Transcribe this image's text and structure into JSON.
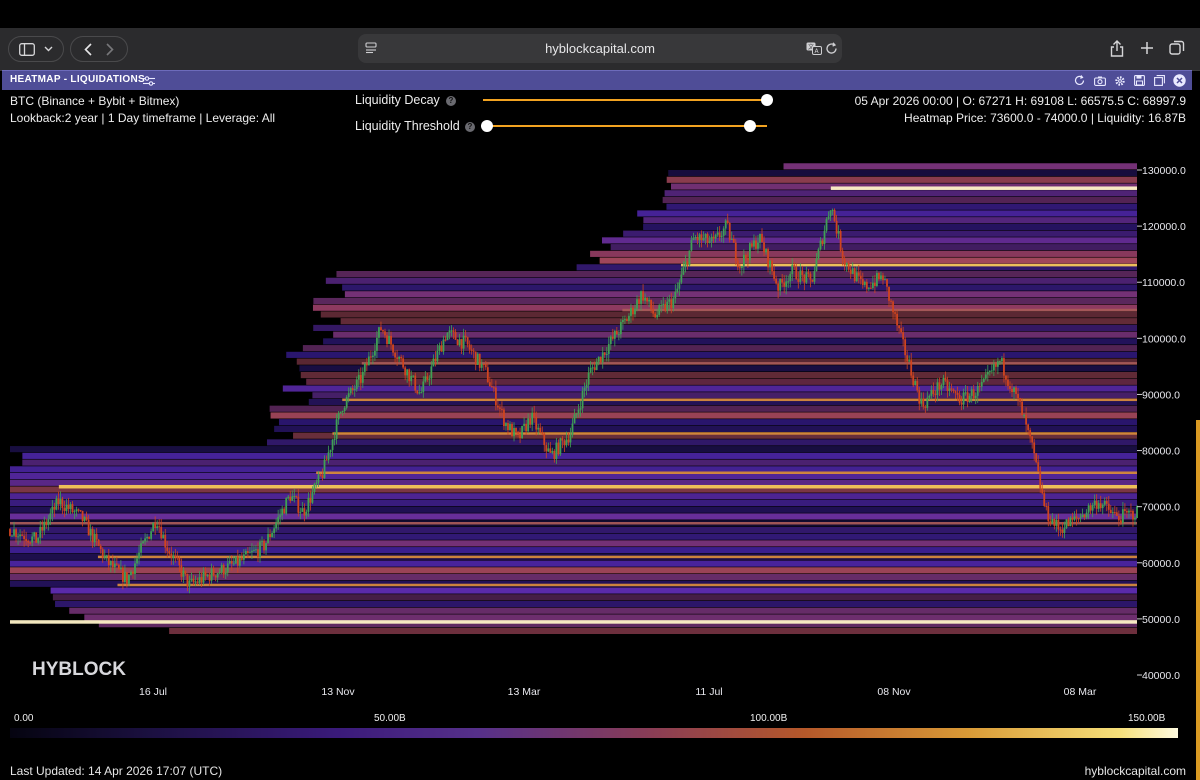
{
  "browser": {
    "url": "hyblockcapital.com"
  },
  "widget": {
    "title": "HEATMAP - LIQUIDATIONS"
  },
  "info": {
    "exchanges": "BTC (Binance + Bybit + Bitmex)",
    "settings": "Lookback:2 year | 1 Day timeframe | Leverage: All",
    "ohlc": "05 Apr 2026 00:00 | O: 67271 H: 69108 L: 66575.5 C: 68997.9",
    "heatmap_summary": "Heatmap Price: 73600.0 - 74000.0 | Liquidity: 16.87B"
  },
  "controls": {
    "decay_label": "Liquidity Decay",
    "threshold_label": "Liquidity Threshold",
    "decay_value": 1.0,
    "threshold_min": 0.0,
    "threshold_max": 0.94
  },
  "chart_data": {
    "type": "heatmap",
    "watermark": "HYBLOCK",
    "x_tick_labels": [
      "16 Jul",
      "13 Nov",
      "13 Mar",
      "11 Jul",
      "08 Nov",
      "08 Mar"
    ],
    "y_tick_labels": [
      "130000.0",
      "120000.0",
      "110000.0",
      "100000.0",
      "90000.0",
      "80000.0",
      "70000.0",
      "60000.0",
      "50000.0",
      "40000.0"
    ],
    "y_ticks": [
      130000,
      120000,
      110000,
      100000,
      90000,
      80000,
      70000,
      60000,
      50000,
      40000
    ],
    "ylim": [
      40000,
      131000
    ],
    "price_path_approx": [
      [
        0,
        66000
      ],
      [
        8,
        64000
      ],
      [
        15,
        71000
      ],
      [
        22,
        68000
      ],
      [
        30,
        60000
      ],
      [
        36,
        57000
      ],
      [
        40,
        62000
      ],
      [
        45,
        68000
      ],
      [
        48,
        63000
      ],
      [
        55,
        56000
      ],
      [
        62,
        58000
      ],
      [
        70,
        60000
      ],
      [
        78,
        63000
      ],
      [
        86,
        72000
      ],
      [
        90,
        69000
      ],
      [
        96,
        76000
      ],
      [
        102,
        88000
      ],
      [
        108,
        93000
      ],
      [
        114,
        102000
      ],
      [
        120,
        96000
      ],
      [
        126,
        90000
      ],
      [
        134,
        101000
      ],
      [
        140,
        99000
      ],
      [
        146,
        94000
      ],
      [
        152,
        85000
      ],
      [
        156,
        82000
      ],
      [
        160,
        86000
      ],
      [
        166,
        79000
      ],
      [
        172,
        83000
      ],
      [
        178,
        94000
      ],
      [
        184,
        99000
      ],
      [
        190,
        104000
      ],
      [
        194,
        108000
      ],
      [
        198,
        104000
      ],
      [
        204,
        107000
      ],
      [
        210,
        118000
      ],
      [
        216,
        117000
      ],
      [
        220,
        120000
      ],
      [
        224,
        113000
      ],
      [
        230,
        118000
      ],
      [
        236,
        109000
      ],
      [
        240,
        112000
      ],
      [
        246,
        110000
      ],
      [
        252,
        124000
      ],
      [
        256,
        114000
      ],
      [
        262,
        109000
      ],
      [
        268,
        111000
      ],
      [
        274,
        99000
      ],
      [
        280,
        88000
      ],
      [
        286,
        92000
      ],
      [
        292,
        89000
      ],
      [
        298,
        91000
      ],
      [
        304,
        96000
      ],
      [
        310,
        88000
      ],
      [
        314,
        80000
      ],
      [
        318,
        69000
      ],
      [
        322,
        66000
      ],
      [
        328,
        68000
      ],
      [
        334,
        71000
      ],
      [
        340,
        68000
      ],
      [
        346,
        69000
      ]
    ],
    "liquidity_bands_approx": [
      {
        "price": 49500,
        "intensity": 1.0
      },
      {
        "price": 126800,
        "intensity": 0.95
      },
      {
        "price": 73600,
        "intensity": 0.9
      },
      {
        "price": 113000,
        "intensity": 0.85
      },
      {
        "price": 89000,
        "intensity": 0.55
      },
      {
        "price": 83000,
        "intensity": 0.6
      },
      {
        "price": 76000,
        "intensity": 0.7
      },
      {
        "price": 56000,
        "intensity": 0.6
      },
      {
        "price": 95500,
        "intensity": 0.45
      },
      {
        "price": 105000,
        "intensity": 0.35
      },
      {
        "price": 61000,
        "intensity": 0.55
      },
      {
        "price": 67000,
        "intensity": 0.4
      }
    ]
  },
  "legend": {
    "min_label": "0.00",
    "mid1_label": "50.00B",
    "mid2_label": "100.00B",
    "max_label": "150.00B",
    "min": 0,
    "max": 150
  },
  "footer": {
    "last_updated": "Last Updated: 14 Apr 2026 17:07 (UTC)",
    "site": "hyblockcapital.com"
  }
}
